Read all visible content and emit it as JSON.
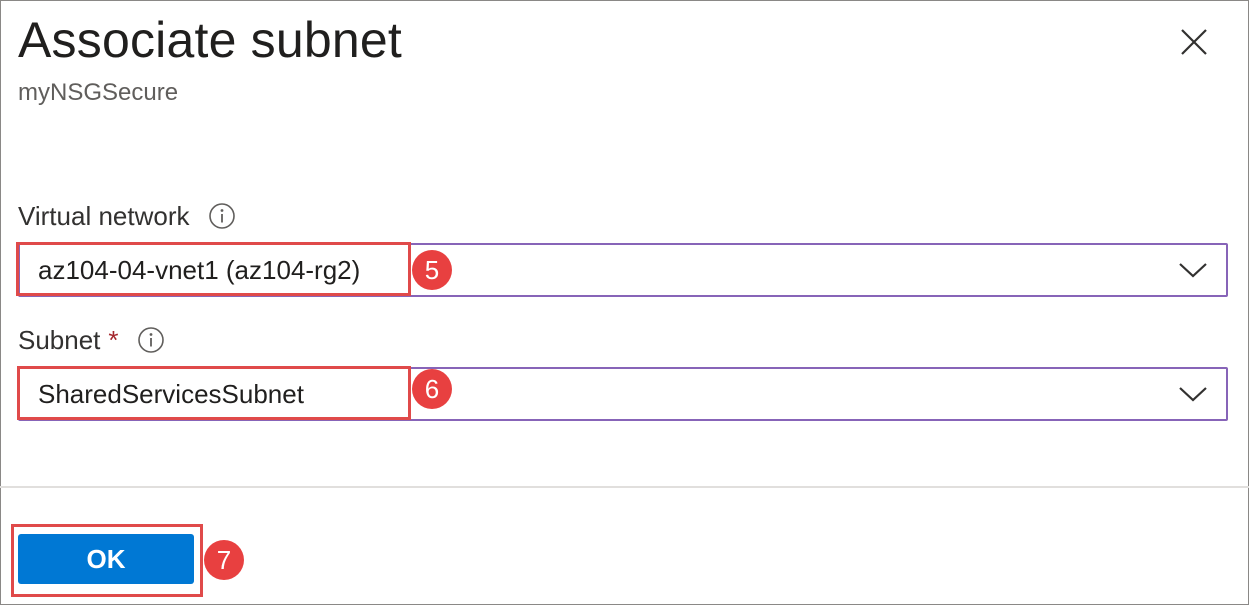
{
  "panel": {
    "title": "Associate subnet",
    "subtitle": "myNSGSecure"
  },
  "fields": {
    "virtual_network": {
      "label": "Virtual network",
      "value": "az104-04-vnet1 (az104-rg2)"
    },
    "subnet": {
      "label": "Subnet",
      "required_mark": "*",
      "value": "SharedServicesSubnet"
    }
  },
  "footer": {
    "ok_label": "OK"
  },
  "callouts": {
    "vnet_step": "5",
    "subnet_step": "6",
    "ok_step": "7"
  },
  "colors": {
    "accent": "#0078d4",
    "select_border": "#8764b8",
    "callout": "#e84040",
    "required": "#a4262c"
  },
  "icons": {
    "close": "close-icon",
    "info": "info-icon",
    "chevron": "chevron-down-icon"
  }
}
